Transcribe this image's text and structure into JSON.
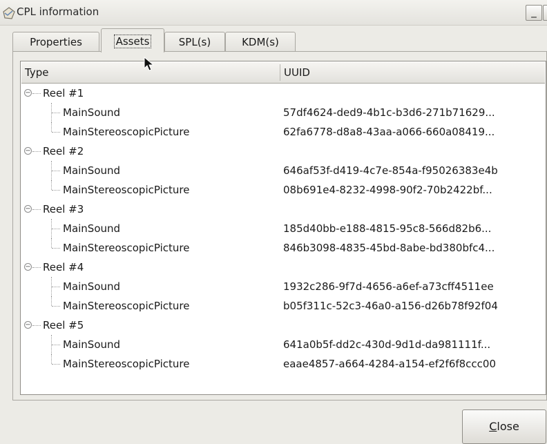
{
  "window": {
    "title": "CPL information",
    "minimize_glyph": "_",
    "close_glyph": "X"
  },
  "tabs": [
    {
      "label": "Properties",
      "active": false
    },
    {
      "label": "Assets",
      "active": true
    },
    {
      "label": "SPL(s)",
      "active": false
    },
    {
      "label": "KDM(s)",
      "active": false
    }
  ],
  "tree": {
    "columns": {
      "type": "Type",
      "uuid": "UUID"
    },
    "reels": [
      {
        "label": "Reel #1",
        "assets": [
          {
            "type": "MainSound",
            "uuid": "57df4624-ded9-4b1c-b3d6-271b71629..."
          },
          {
            "type": "MainStereoscopicPicture",
            "uuid": "62fa6778-d8a8-43aa-a066-660a08419..."
          }
        ]
      },
      {
        "label": "Reel #2",
        "assets": [
          {
            "type": "MainSound",
            "uuid": "646af53f-d419-4c7e-854a-f95026383e4b"
          },
          {
            "type": "MainStereoscopicPicture",
            "uuid": "08b691e4-8232-4998-90f2-70b2422bf..."
          }
        ]
      },
      {
        "label": "Reel #3",
        "assets": [
          {
            "type": "MainSound",
            "uuid": "185d40bb-e188-4815-95c8-566d82b6..."
          },
          {
            "type": "MainStereoscopicPicture",
            "uuid": "846b3098-4835-45bd-8abe-bd380bfc4..."
          }
        ]
      },
      {
        "label": "Reel #4",
        "assets": [
          {
            "type": "MainSound",
            "uuid": "1932c286-9f7d-4656-a6ef-a73cff4511ee"
          },
          {
            "type": "MainStereoscopicPicture",
            "uuid": "b05f311c-52c3-46a0-a156-d26b78f92f04"
          }
        ]
      },
      {
        "label": "Reel #5",
        "assets": [
          {
            "type": "MainSound",
            "uuid": "641a0b5f-dd2c-430d-9d1d-da981111f..."
          },
          {
            "type": "MainStereoscopicPicture",
            "uuid": "eaae4857-a664-4284-a154-ef2f6f8ccc00"
          }
        ]
      }
    ]
  },
  "buttons": {
    "close_label": "Close",
    "close_mnemonic": "C",
    "close_rest": "lose"
  },
  "icons": {
    "app": "cpl-info-icon",
    "expander": "tree-collapse-icon",
    "cursor": "mouse-pointer-icon"
  }
}
